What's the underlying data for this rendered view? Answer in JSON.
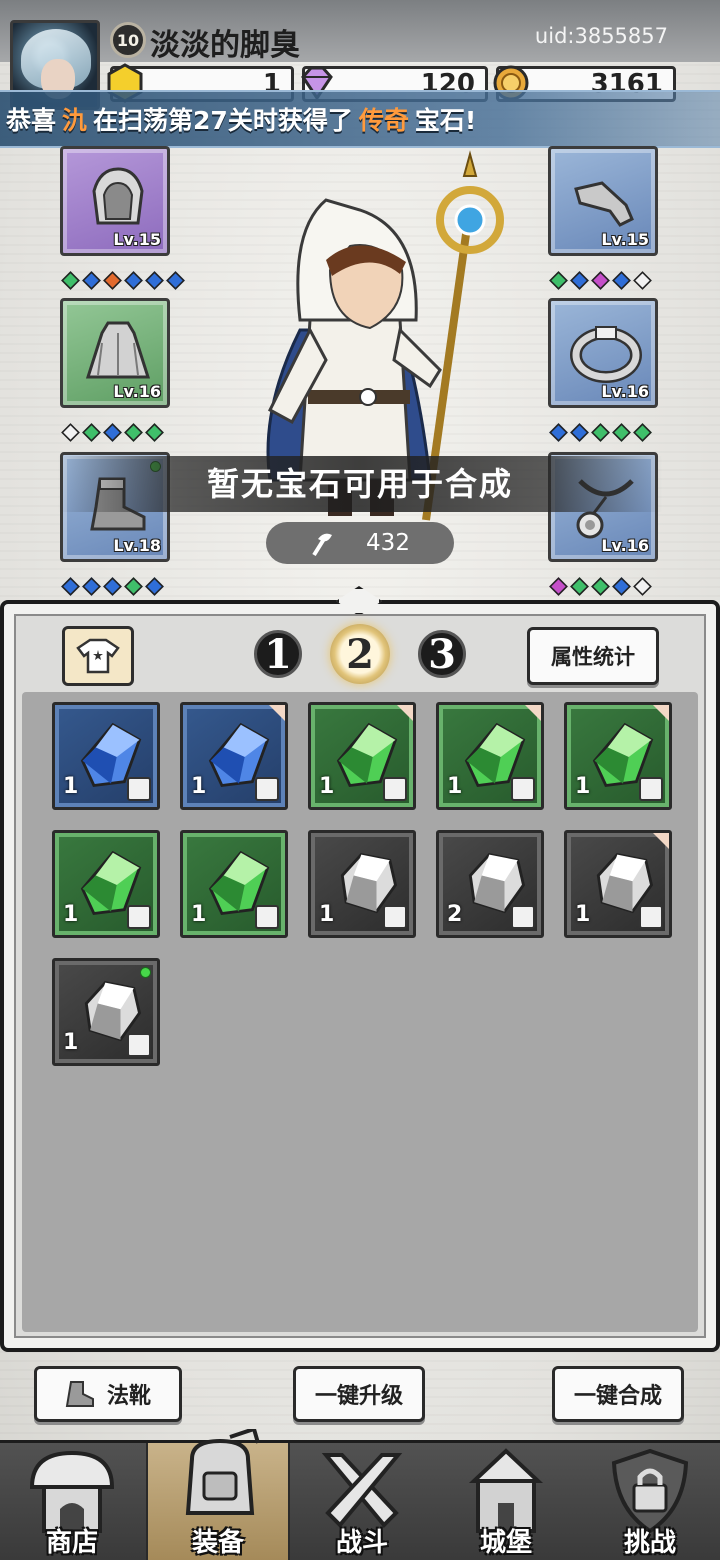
{
  "player": {
    "level": "10",
    "name": "淡淡的脚臭",
    "uid": "uid:3855857"
  },
  "resources": {
    "energy": "1",
    "gems": "120",
    "gold": "3161"
  },
  "announcement": {
    "prefix": "恭喜",
    "player": "氿",
    "middle": "在扫荡第27关时获得了",
    "rarity": "传奇",
    "suffix": "宝石!"
  },
  "equipment": {
    "left": [
      {
        "name": "hood",
        "level": "Lv.15",
        "color": "purple",
        "gems": [
          "#3fbf6a",
          "#2f6ed8",
          "#e36a2d",
          "#2f6ed8",
          "#2f6ed8",
          "#2f6ed8"
        ]
      },
      {
        "name": "cloak",
        "level": "Lv.16",
        "color": "green",
        "gems": [
          "#f2f2f2",
          "#3fbf6a",
          "#2f6ed8",
          "#3fbf6a",
          "#3fbf6a"
        ]
      },
      {
        "name": "boots",
        "level": "Lv.18",
        "color": "blue",
        "gems": [
          "#2f6ed8",
          "#2f6ed8",
          "#2f6ed8",
          "#3fbf6a",
          "#2f6ed8"
        ]
      }
    ],
    "right": [
      {
        "name": "gloves",
        "level": "Lv.15",
        "color": "blue",
        "gems": [
          "#3fbf6a",
          "#2f6ed8",
          "#c54fc9",
          "#2f6ed8",
          "#f2f2f2"
        ]
      },
      {
        "name": "ring",
        "level": "Lv.16",
        "color": "blue",
        "gems": [
          "#2f6ed8",
          "#2f6ed8",
          "#3fbf6a",
          "#3fbf6a",
          "#3fbf6a"
        ]
      },
      {
        "name": "necklace",
        "level": "Lv.16",
        "color": "blue",
        "gems": [
          "#c54fc9",
          "#3fbf6a",
          "#3fbf6a",
          "#2f6ed8",
          "#f2f2f2"
        ]
      }
    ]
  },
  "tip": "暂无宝石可用于合成",
  "power": "432",
  "tabs": {
    "pages": [
      "1",
      "2",
      "3"
    ],
    "active_page": "2",
    "stats_label": "属性统计"
  },
  "gem_inventory": [
    {
      "color": "blue",
      "count": "1",
      "corner": false,
      "new": false
    },
    {
      "color": "blue",
      "count": "1",
      "corner": true,
      "new": false
    },
    {
      "color": "green",
      "count": "1",
      "corner": true,
      "new": false
    },
    {
      "color": "green",
      "count": "1",
      "corner": true,
      "new": false
    },
    {
      "color": "green",
      "count": "1",
      "corner": true,
      "new": false
    },
    {
      "color": "green",
      "count": "1",
      "corner": false,
      "new": false
    },
    {
      "color": "green",
      "count": "1",
      "corner": false,
      "new": false
    },
    {
      "color": "gray",
      "count": "1",
      "corner": false,
      "new": false
    },
    {
      "color": "gray",
      "count": "2",
      "corner": false,
      "new": false
    },
    {
      "color": "gray",
      "count": "1",
      "corner": true,
      "new": false
    },
    {
      "color": "gray",
      "count": "1",
      "corner": false,
      "new": true
    }
  ],
  "actions": {
    "slot_filter_label": "法靴",
    "upgrade_all_label": "一键升级",
    "combine_all_label": "一键合成"
  },
  "nav": [
    {
      "label": "商店",
      "icon": "shop-icon"
    },
    {
      "label": "装备",
      "icon": "backpack-icon"
    },
    {
      "label": "战斗",
      "icon": "crossed-swords-icon"
    },
    {
      "label": "城堡",
      "icon": "castle-icon"
    },
    {
      "label": "挑战",
      "icon": "locked-shield-icon"
    }
  ],
  "colors": {
    "announce_highlight": "#ff9a3c",
    "gem_blue": "#2f6ed8",
    "gem_green": "#3fbf6a"
  }
}
